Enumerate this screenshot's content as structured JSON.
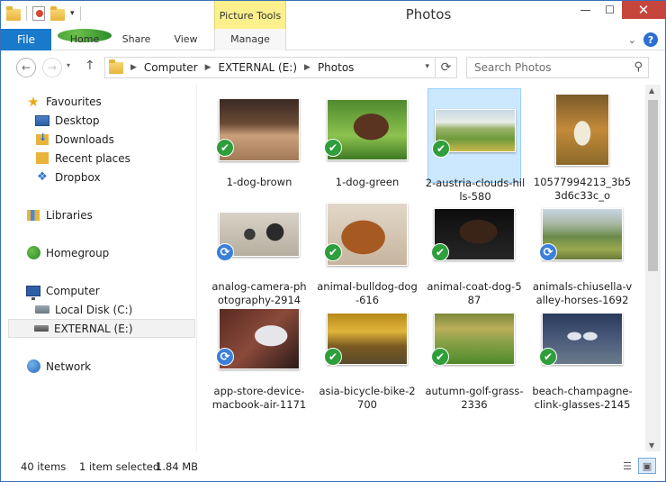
{
  "window": {
    "title": "Photos",
    "contextual_tab": "Picture Tools",
    "buttons": {
      "minimize": "—",
      "maximize": "☐",
      "close": "✕"
    }
  },
  "ribbon": {
    "tabs": [
      "File",
      "Home",
      "Share",
      "View",
      "Manage"
    ]
  },
  "address": {
    "crumbs": [
      "Computer",
      "EXTERNAL (E:)",
      "Photos"
    ],
    "search_placeholder": "Search Photos"
  },
  "nav": {
    "favourites": "Favourites",
    "desktop": "Desktop",
    "downloads": "Downloads",
    "recent": "Recent places",
    "dropbox": "Dropbox",
    "libraries": "Libraries",
    "homegroup": "Homegroup",
    "computer": "Computer",
    "local_disk": "Local Disk (C:)",
    "external": "EXTERNAL (E:)",
    "network": "Network"
  },
  "files": [
    {
      "name": "1-dog-brown",
      "status": "ok"
    },
    {
      "name": "1-dog-green",
      "status": "ok"
    },
    {
      "name": "2-austria-clouds-hills-580",
      "status": "ok",
      "selected": true
    },
    {
      "name": "10577994213_3b53d6c33c_o",
      "status": "none"
    },
    {
      "name": "analog-camera-photography-2914",
      "status": "sync"
    },
    {
      "name": "animal-bulldog-dog-616",
      "status": "ok"
    },
    {
      "name": "animal-coat-dog-587",
      "status": "ok"
    },
    {
      "name": "animals-chiusella-valley-horses-1692",
      "status": "sync"
    },
    {
      "name": "app-store-device-macbook-air-1171",
      "status": "sync"
    },
    {
      "name": "asia-bicycle-bike-2700",
      "status": "ok"
    },
    {
      "name": "autumn-golf-grass-2336",
      "status": "ok"
    },
    {
      "name": "beach-champagne-clink-glasses-2145",
      "status": "ok"
    }
  ],
  "status": {
    "count": "40 items",
    "selection": "1 item selected",
    "size": "1.84 MB"
  },
  "icons": {
    "ok_badge": "✔",
    "sync_badge": "⟳"
  }
}
